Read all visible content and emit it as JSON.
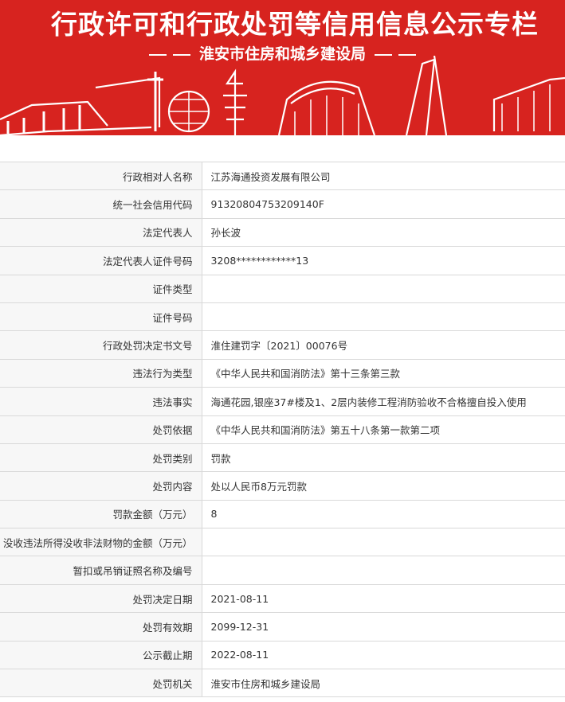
{
  "banner": {
    "title": "行政许可和行政处罚等信用信息公示专栏",
    "subtitle": "淮安市住房和城乡建设局"
  },
  "records": [
    {
      "label": "行政相对人名称",
      "value": "江苏海通投资发展有限公司"
    },
    {
      "label": "统一社会信用代码",
      "value": "91320804753209140F"
    },
    {
      "label": "法定代表人",
      "value": "孙长波"
    },
    {
      "label": "法定代表人证件号码",
      "value": "3208************13"
    },
    {
      "label": "证件类型",
      "value": ""
    },
    {
      "label": "证件号码",
      "value": ""
    },
    {
      "label": "行政处罚决定书文号",
      "value": "淮住建罚字〔2021〕00076号"
    },
    {
      "label": "违法行为类型",
      "value": "《中华人民共和国消防法》第十三条第三款"
    },
    {
      "label": "违法事实",
      "value": "海通花园,银座37#楼及1、2层内装修工程消防验收不合格擅自投入使用"
    },
    {
      "label": "处罚依据",
      "value": "《中华人民共和国消防法》第五十八条第一款第二项"
    },
    {
      "label": "处罚类别",
      "value": "罚款"
    },
    {
      "label": "处罚内容",
      "value": "处以人民币8万元罚款"
    },
    {
      "label": "罚款金额（万元）",
      "value": "8"
    },
    {
      "label": "没收违法所得没收非法财物的金额（万元）",
      "value": ""
    },
    {
      "label": "暂扣或吊销证照名称及编号",
      "value": ""
    },
    {
      "label": "处罚决定日期",
      "value": "2021-08-11"
    },
    {
      "label": "处罚有效期",
      "value": "2099-12-31"
    },
    {
      "label": "公示截止期",
      "value": "2022-08-11"
    },
    {
      "label": "处罚机关",
      "value": "淮安市住房和城乡建设局"
    }
  ]
}
